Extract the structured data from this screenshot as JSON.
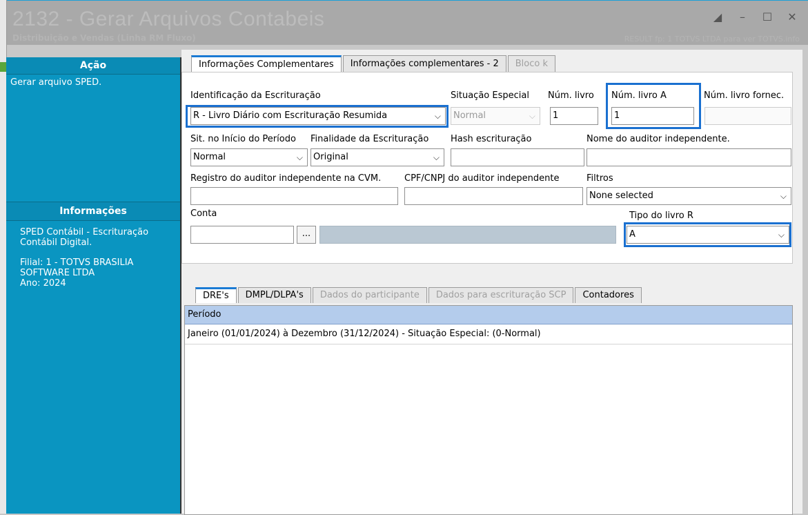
{
  "window": {
    "title": "2132 - Gerar Arquivos Contabeis",
    "subtitle": "Distribuição e Vendas (Linha RM Fluxo)",
    "subtitle_right": "RESULT fp: 1 TOTVS LTDA para ver TOTVS.info",
    "controls": [
      "restore-alt",
      "minimize",
      "maximize",
      "close"
    ]
  },
  "sidebar": {
    "acao_header": "Ação",
    "acao_text": "Gerar arquivo SPED.",
    "info_header": "Informações",
    "info_lines": [
      "SPED Contábil - Escrituração Contábil Digital.",
      "Filial: 1 - TOTVS BRASILIA SOFTWARE LTDA",
      "Ano: 2024"
    ]
  },
  "tabs": [
    {
      "label": "Informações Complementares",
      "active": true
    },
    {
      "label": "Informações complementares - 2",
      "active": false
    },
    {
      "label": "Bloco k",
      "active": false,
      "disabled": true
    }
  ],
  "form": {
    "identificacao_label": "Identificação da Escrituração",
    "identificacao_value": "R - Livro Diário com Escrituração Resumida",
    "situacao_label": "Situação Especial",
    "situacao_value": "Normal",
    "num_livro_label": "Núm. livro",
    "num_livro_value": "1",
    "num_livro_a_label": "Núm. livro A",
    "num_livro_a_value": "1",
    "num_livro_fornec_label": "Núm. livro fornec.",
    "num_livro_fornec_value": "",
    "sit_inicio_label": "Sit. no Início do Período",
    "sit_inicio_value": "Normal",
    "finalidade_label": "Finalidade da Escrituração",
    "finalidade_value": "Original",
    "hash_label": "Hash escrituração",
    "hash_value": "",
    "auditor_nome_label": "Nome do auditor independente.",
    "auditor_nome_value": "",
    "registro_cvm_label": "Registro do auditor independente na CVM.",
    "registro_cvm_value": "",
    "cpf_cnpj_label": "CPF/CNPJ do auditor independente",
    "cpf_cnpj_value": "",
    "filtros_label": "Filtros",
    "filtros_value": "None selected",
    "conta_label": "Conta",
    "conta_value": "",
    "conta_button": "...",
    "tipo_livro_label": "Tipo do livro R",
    "tipo_livro_value": "A"
  },
  "lower_tabs": [
    {
      "label": "DRE's",
      "active": true
    },
    {
      "label": "DMPL/DLPA's",
      "active": false
    },
    {
      "label": "Dados do participante",
      "active": false,
      "disabled": true
    },
    {
      "label": "Dados para escrituração SCP",
      "active": false,
      "disabled": true
    },
    {
      "label": "Contadores",
      "active": false
    }
  ],
  "grid": {
    "header": "Período",
    "rows": [
      "Janeiro (01/01/2024) à Dezembro (31/12/2024) - Situação Especial:  (0-Normal)"
    ]
  }
}
